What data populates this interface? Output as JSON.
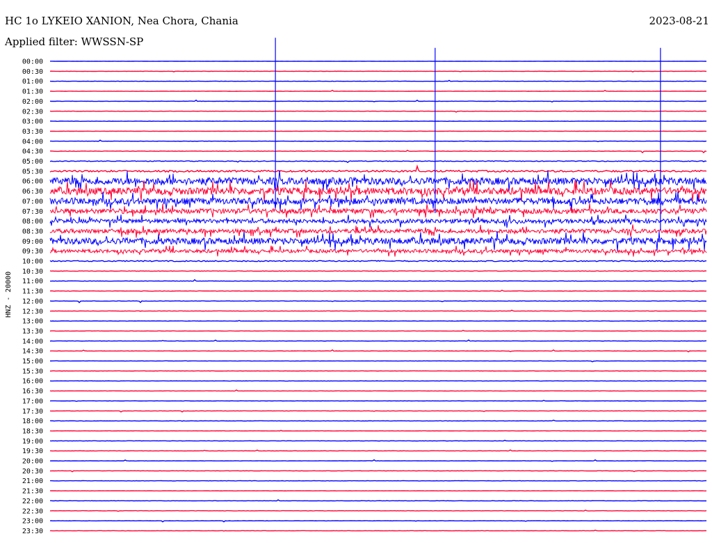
{
  "header": {
    "station_title": "HC 1o LYKEIO XANION, Nea Chora, Chania",
    "filter_label": "Applied filter: WWSSN-SP",
    "date": "2023-08-21"
  },
  "chart_data": {
    "type": "line",
    "title": "HC 1o LYKEIO XANION, Nea Chora, Chania",
    "subtitle": "Applied filter: WWSSN-SP",
    "date": "2023-08-21",
    "ylabel": "HNZ - 20000",
    "xlabel": "",
    "row_interval_minutes": 30,
    "row_labels": [
      "00:00",
      "00:30",
      "01:00",
      "01:30",
      "02:00",
      "02:30",
      "03:00",
      "03:30",
      "04:00",
      "04:30",
      "05:00",
      "05:30",
      "06:00",
      "06:30",
      "07:00",
      "07:30",
      "08:00",
      "08:30",
      "09:00",
      "09:30",
      "10:00",
      "10:30",
      "11:00",
      "11:30",
      "12:00",
      "12:30",
      "13:00",
      "13:30",
      "14:00",
      "14:30",
      "15:00",
      "15:30",
      "16:00",
      "16:30",
      "17:00",
      "17:30",
      "18:00",
      "18:30",
      "19:00",
      "19:30",
      "20:00",
      "20:30",
      "21:00",
      "21:30",
      "22:00",
      "22:30",
      "23:00",
      "23:30"
    ],
    "trace_colors": [
      "#0000ff",
      "#ff0033"
    ],
    "row_activity": [
      0.3,
      0.3,
      0.35,
      0.35,
      0.35,
      0.4,
      0.35,
      0.35,
      0.4,
      0.5,
      0.9,
      2.5,
      10,
      10,
      9,
      7,
      6,
      6,
      9,
      5,
      1.5,
      0.6,
      0.5,
      0.5,
      0.5,
      0.4,
      0.4,
      0.35,
      0.35,
      0.35,
      0.35,
      0.35,
      0.35,
      0.35,
      0.35,
      0.35,
      0.4,
      0.4,
      0.35,
      0.35,
      0.35,
      0.35,
      0.35,
      0.35,
      0.35,
      0.35,
      0.35,
      0.35
    ],
    "spikes": [
      {
        "start_row": 1.0,
        "end_row": 14.5,
        "minute": 10.3,
        "color": "#0000ff"
      },
      {
        "start_row": 2.0,
        "end_row": 15.2,
        "minute": 17.6,
        "color": "#0000ff"
      },
      {
        "start_row": 2.0,
        "end_row": 16.9,
        "minute": 27.9,
        "color": "#0000ff"
      }
    ]
  }
}
